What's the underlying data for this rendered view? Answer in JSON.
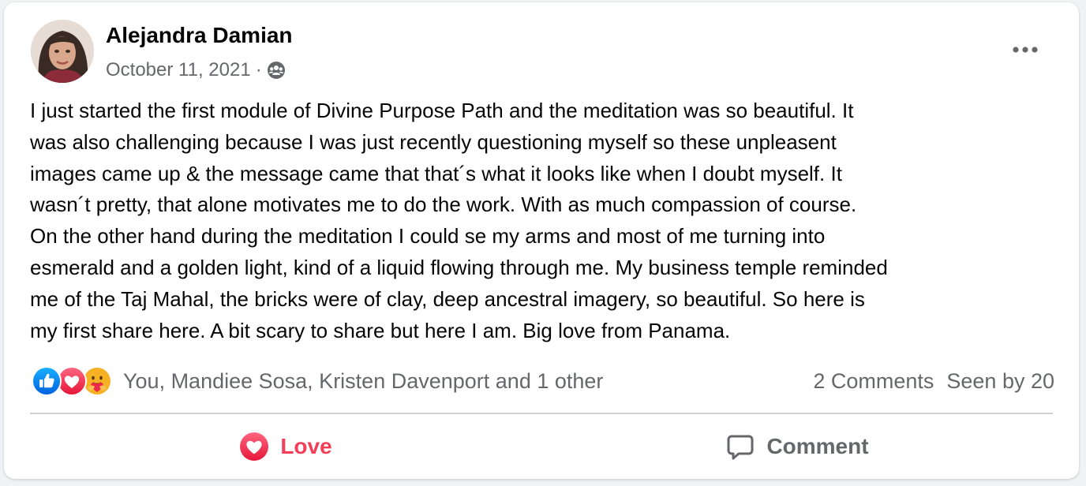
{
  "post": {
    "author": "Alejandra Damian",
    "date": "October 11, 2021",
    "separator": "·",
    "audience_icon": "group-icon",
    "more_icon": "more-options-icon",
    "text": "I just started the first module of Divine Purpose Path and the meditation was so beautiful. It\nwas also challenging because I was just recently questioning myself so these unpleasent\nimages came up & the message came that that´s what it looks like when I doubt myself. It\nwasn´t pretty, that alone motivates me to do the work. With as much compassion of course.\nOn the other hand during the meditation I could se my arms and most of me turning into\nesmerald and a golden light, kind of a liquid flowing through me. My business temple reminded\nme of the Taj Mahal, the bricks were of clay, deep ancestral imagery, so beautiful. So here is\nmy first share here. A bit scary to share but here I am. Big love from Panama."
  },
  "reactions": {
    "icons": [
      "like-icon",
      "love-icon",
      "care-icon"
    ],
    "names": "You, Mandiee Sosa, Kristen Davenport and 1 other",
    "comments": "2 Comments",
    "seen": "Seen by 20"
  },
  "actions": {
    "love_label": "Love",
    "comment_label": "Comment"
  },
  "colors": {
    "love": "#f33e58",
    "like": "#1877f2",
    "care": "#f7b125",
    "secondary_text": "#65676b",
    "primary_text": "#050505"
  }
}
